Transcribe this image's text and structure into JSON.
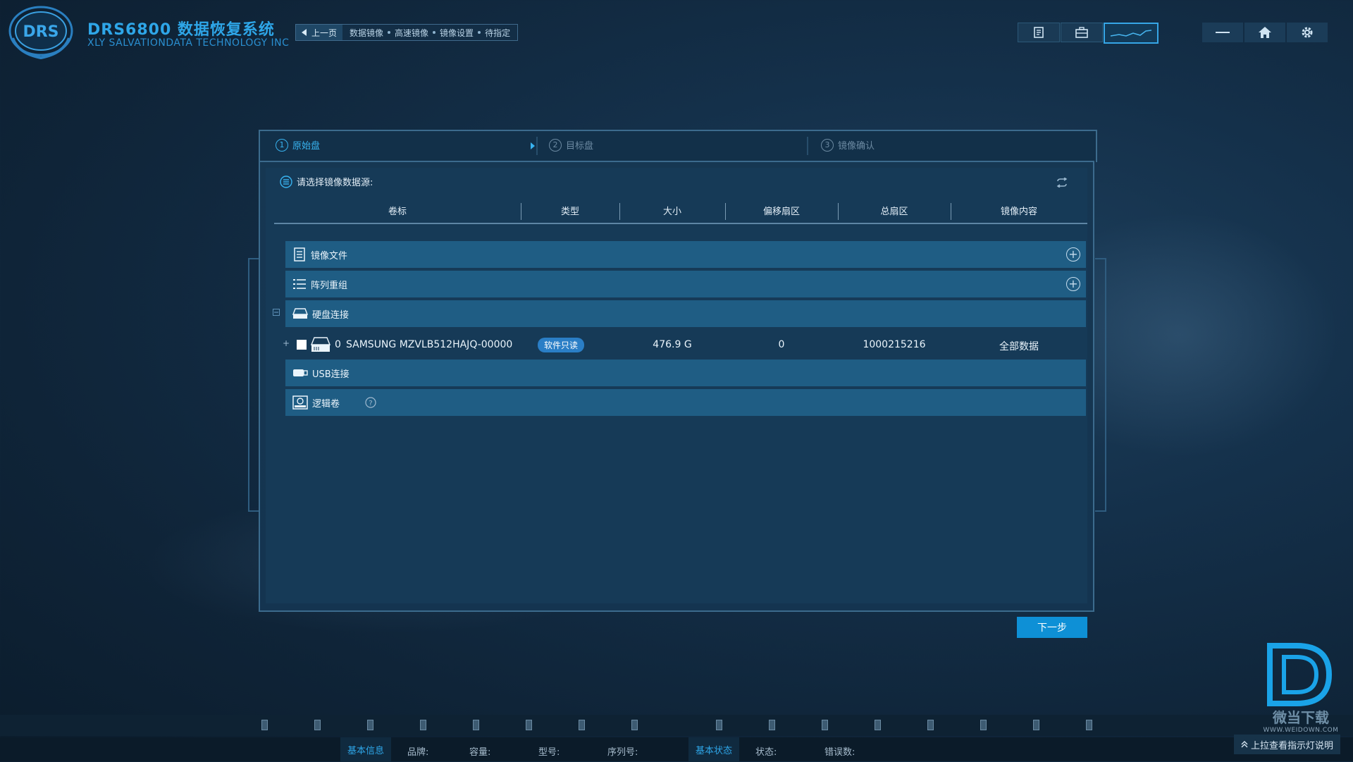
{
  "app": {
    "title": "DRS6800 数据恢复系统",
    "subtitle": "XLY SALVATIONDATA TECHNOLOGY INC",
    "logo_text": "DRS"
  },
  "breadcrumb": {
    "back_label": "上一页",
    "items": [
      "数据镜像",
      "高速镜像",
      "镜像设置",
      "待指定"
    ]
  },
  "toolbar": {
    "icons": [
      "report-icon",
      "toolbox-icon",
      "waveform-monitor-icon"
    ]
  },
  "window_controls": {
    "icons": [
      "minimize-icon",
      "home-icon",
      "settings-gear-icon"
    ]
  },
  "steps": [
    {
      "num": "1",
      "label": "原始盘",
      "active": true
    },
    {
      "num": "2",
      "label": "目标盘",
      "active": false
    },
    {
      "num": "3",
      "label": "镜像确认",
      "active": false
    }
  ],
  "source": {
    "title": "请选择镜像数据源:",
    "columns": [
      "卷标",
      "类型",
      "大小",
      "偏移扇区",
      "总扇区",
      "镜像内容"
    ],
    "groups": {
      "image_file": "镜像文件",
      "raid": "阵列重组",
      "disk": "硬盘连接",
      "usb": "USB连接",
      "logical": "逻辑卷"
    },
    "disk": {
      "index": "0",
      "name": "SAMSUNG MZVLB512HAJQ-00000",
      "type_badge": "软件只读",
      "size": "476.9 G",
      "offset": "0",
      "total_sectors": "1000215216",
      "content": "全部数据"
    }
  },
  "next_label": "下一步",
  "status": {
    "basic_info_tab": "基本信息",
    "brand_label": "品牌:",
    "capacity_label": "容量:",
    "model_label": "型号:",
    "serial_label": "序列号:",
    "basic_status_tab": "基本状态",
    "state_label": "状态:",
    "error_count_label": "错误数:"
  },
  "hint": "上拉查看指示灯说明",
  "watermark": {
    "text": "微当下载",
    "url": "WWW.WEIDOWN.COM"
  },
  "colors": {
    "accent": "#2ea6e8",
    "group_row": "#1f5d84",
    "next_button": "#0e90d6",
    "badge": "#2a7ec6"
  }
}
